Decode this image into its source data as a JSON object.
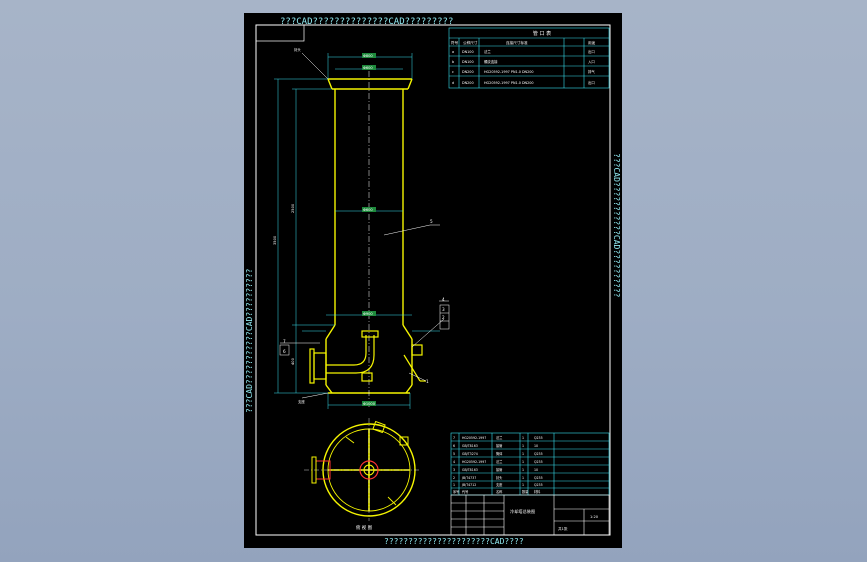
{
  "colors": {
    "background": "#a3b1c6",
    "sheet": "#000000",
    "frame": "#ffffff",
    "watermark": "#8fe8f0",
    "vessel": "#f5f500",
    "dimension": "#38e0ee",
    "pipe": "#ff3333",
    "table": "#38e0ee",
    "text": "#ffffff"
  },
  "watermarks": {
    "top": "???CAD??????????????CAD?????????",
    "bottom": "??????????????????????CAD????",
    "left": "???CAD???????????CAD??????????",
    "right": "???CAD???????????CAD??????????"
  },
  "nozzle_table": {
    "title": "管 口 表",
    "headers": [
      "符号",
      "公称尺寸",
      "连接尺寸标准",
      "用途"
    ],
    "rows": [
      [
        "a",
        "DN100",
        "法兰",
        "出口"
      ],
      [
        "b",
        "DN100",
        "螺纹连接",
        "入口"
      ],
      [
        "c",
        "DN200",
        "HG20592-1997 PN1.0 DN200",
        "排气"
      ],
      [
        "d",
        "DN200",
        "HG20592-1997 PN1.0 DN200",
        "出口"
      ]
    ]
  },
  "parts_list": {
    "rows": [
      [
        "7",
        "HG20592-1997",
        "法兰",
        "1",
        "Q235"
      ],
      [
        "6",
        "GB/T8163",
        "接管",
        "1",
        "10"
      ],
      [
        "5",
        "GB/T3274",
        "筒体",
        "1",
        "Q235"
      ],
      [
        "4",
        "HG20592-1997",
        "法兰",
        "1",
        "Q235"
      ],
      [
        "3",
        "GB/T8163",
        "接管",
        "1",
        "10"
      ],
      [
        "2",
        "JB/T4737",
        "封头",
        "1",
        "Q235"
      ],
      [
        "1",
        "JB/T4712",
        "支座",
        "1",
        "Q235"
      ]
    ],
    "header": [
      "序号",
      "代号",
      "名称",
      "数量",
      "材料"
    ]
  },
  "title_block": {
    "drawing_name": "冷却塔总装图",
    "scale": "1:20",
    "sheet": "共1张"
  },
  "labels": {
    "top_cap": "封头",
    "bottom_support": "支座",
    "section_view": "俯 视 图",
    "part5": "5",
    "part1": "1",
    "part2": "2",
    "part3": "3",
    "part4": "4",
    "part6": "6",
    "part7": "7"
  },
  "dimensions": {
    "total_height": "3500",
    "shell_height": "2500",
    "upper_section": "600",
    "lower_section": "400",
    "diameter_top": "Φ800",
    "diameter_mid": "Φ600",
    "diameter_bottom": "Φ900",
    "diameter_base": "Φ1000"
  }
}
